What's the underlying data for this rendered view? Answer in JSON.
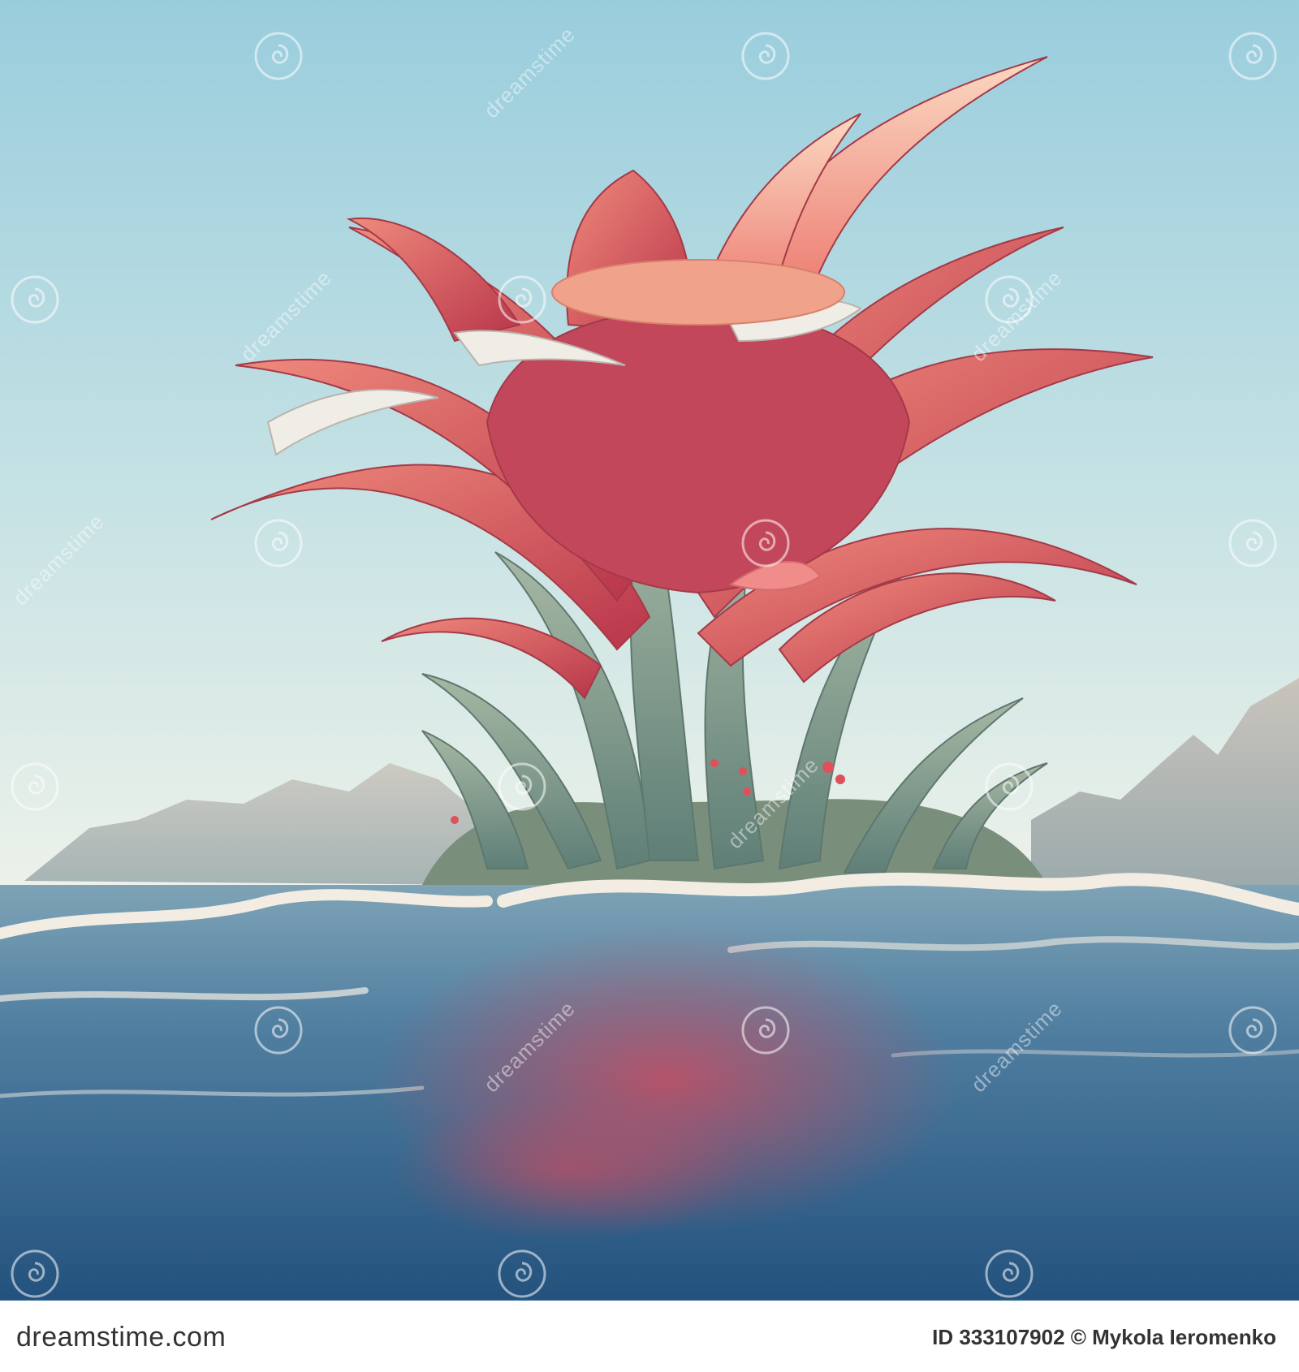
{
  "footer": {
    "brand": "dreamstime.com",
    "credit": "ID 333107902 © Mykola Ieromenko"
  },
  "watermark": {
    "text": "dreamstime",
    "icon": "dreamstime-swirl-logo"
  },
  "colors": {
    "sky_top": "#9fcfdc",
    "sky_bottom": "#e9f1ec",
    "petal_red": "#d9505c",
    "petal_coral": "#f07d6f",
    "leaf_green": "#7f9b90",
    "sea_dark": "#2f5e86",
    "sea_light": "#6f97ad",
    "footer_bg": "#ffffff"
  }
}
